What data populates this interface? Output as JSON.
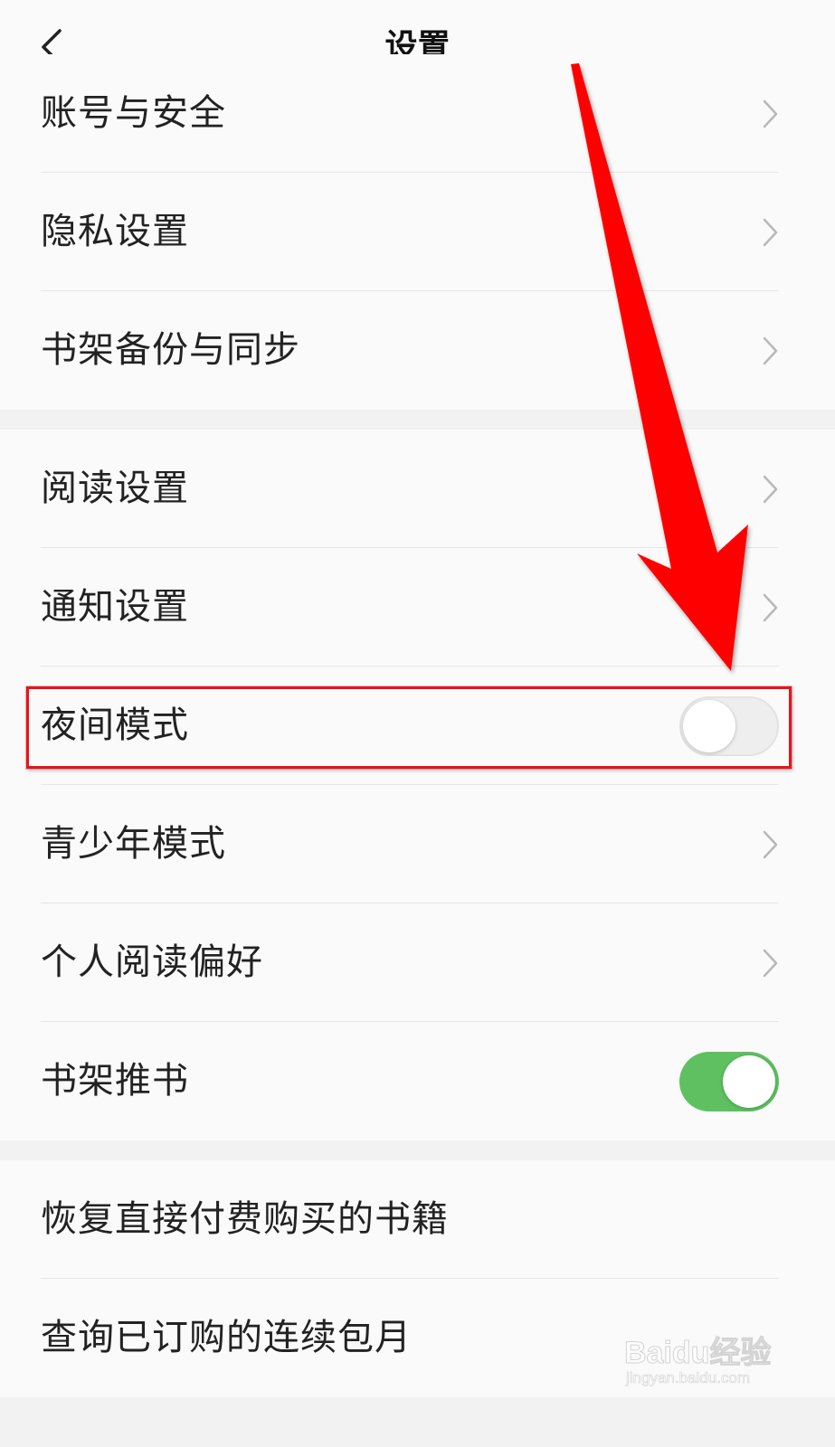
{
  "header": {
    "title": "设置",
    "back_icon": "chevron-left-icon"
  },
  "groups": [
    {
      "items": [
        {
          "label": "账号与安全",
          "control": "chevron"
        },
        {
          "label": "隐私设置",
          "control": "chevron"
        },
        {
          "label": "书架备份与同步",
          "control": "chevron"
        }
      ]
    },
    {
      "items": [
        {
          "label": "阅读设置",
          "control": "chevron"
        },
        {
          "label": "通知设置",
          "control": "chevron"
        },
        {
          "label": "夜间模式",
          "control": "toggle",
          "toggle_on": false,
          "highlighted": true
        },
        {
          "label": "青少年模式",
          "control": "chevron"
        },
        {
          "label": "个人阅读偏好",
          "control": "chevron"
        },
        {
          "label": "书架推书",
          "control": "toggle",
          "toggle_on": true
        }
      ]
    },
    {
      "items": [
        {
          "label": "恢复直接付费购买的书籍",
          "control": "none"
        },
        {
          "label": "查询已订购的连续包月",
          "control": "none"
        }
      ]
    }
  ],
  "annotation": {
    "arrow_color": "#ff0000",
    "highlight_color": "#e8141a"
  },
  "watermark": {
    "main": "Baidu经验",
    "sub": "jingyan.baidu.com"
  },
  "colors": {
    "toggle_on": "#5ec060",
    "toggle_off": "#eeeeee",
    "background": "#fafafa",
    "separator": "#f2f2f2"
  }
}
